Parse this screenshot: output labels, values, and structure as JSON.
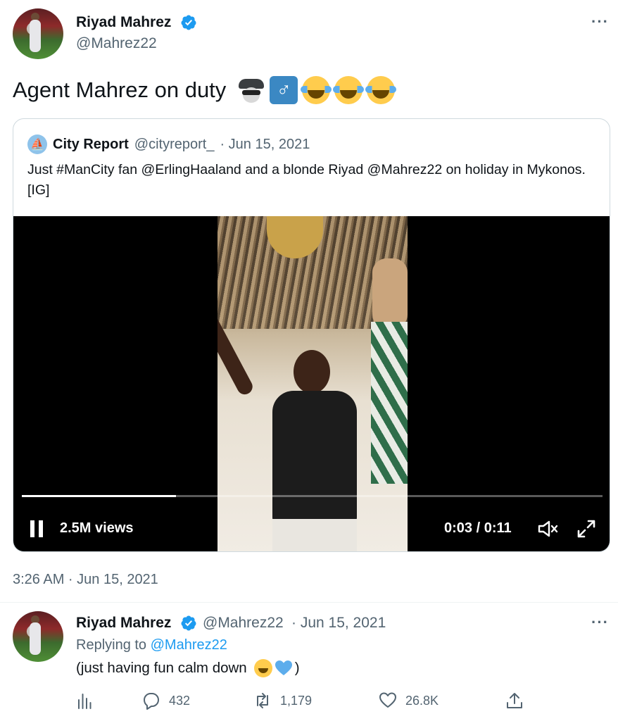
{
  "main_tweet": {
    "author_name": "Riyad Mahrez",
    "author_handle": "@Mahrez22",
    "verified": true,
    "text": "Agent Mahrez on duty",
    "emoji": [
      "detective",
      "male-sign",
      "face-with-tears-of-joy",
      "face-with-tears-of-joy",
      "face-with-tears-of-joy"
    ],
    "more_label": "···",
    "timestamp": "3:26 AM · Jun 15, 2021"
  },
  "quoted_tweet": {
    "author_name": "City Report",
    "author_handle": "@cityreport_",
    "date": "· Jun 15, 2021",
    "text": "Just #ManCity fan @ErlingHaaland and a blonde Riyad @Mahrez22 on holiday in Mykonos. [IG]",
    "video": {
      "views": "2.5M views",
      "time": "0:03 / 0:11",
      "progress": 0.265,
      "muted": true,
      "playing": true
    }
  },
  "reply": {
    "author_name": "Riyad Mahrez",
    "author_handle": "@Mahrez22",
    "date": "· Jun 15, 2021",
    "replying_prefix": "Replying to",
    "replying_to": "@Mahrez22",
    "text_open": "(just having fun calm down",
    "text_close": ")",
    "emoji": [
      "face-with-tears-of-joy",
      "blue-heart"
    ],
    "more_label": "···",
    "actions": {
      "analytics_icon": "analytics-icon",
      "replies": "432",
      "retweets": "1,179",
      "likes": "26.8K",
      "share_icon": "share-icon"
    }
  },
  "colors": {
    "text": "#0f1419",
    "muted": "#536471",
    "link": "#1d9bf0",
    "verified": "#1d9bf0",
    "border": "#cfd9de"
  }
}
